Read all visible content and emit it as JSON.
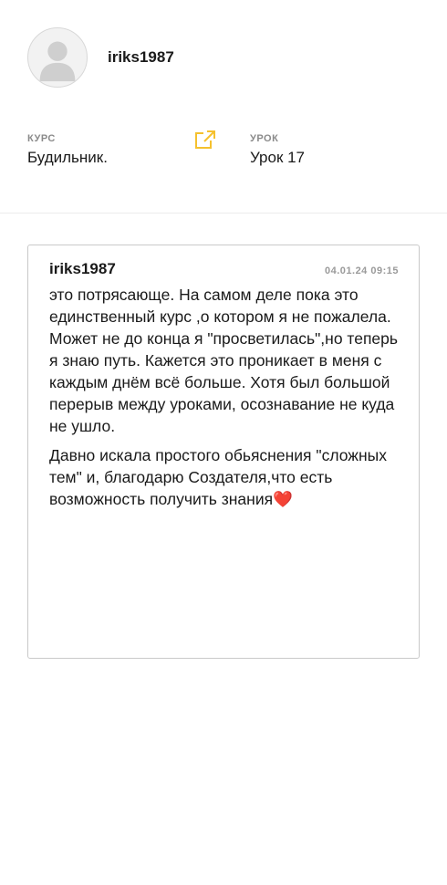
{
  "profile": {
    "username": "iriks1987",
    "avatar_icon": "user-silhouette-icon"
  },
  "course": {
    "label": "КУРС",
    "value": "Будильник.",
    "link_icon": "external-link-icon",
    "link_color": "#f5c12e"
  },
  "lesson": {
    "label": "УРОК",
    "value": "Урок 17"
  },
  "comment": {
    "author": "iriks1987",
    "date": "04.01.24 09:15",
    "paragraph_1": "это потрясающе. На самом деле пока это единственный курс ,о котором я не пожалела. Может не до конца я \"просветилась\",но теперь я знаю путь. Кажется это проникает в меня с каждым днём всё больше. Хотя был большой перерыв между уроками, осознавание не куда не ушло.",
    "paragraph_2": "Давно искала простого обьяснения \"сложных тем\" и, благодарю Создателя,что есть возможность получить знания",
    "emoji": "❤️"
  }
}
